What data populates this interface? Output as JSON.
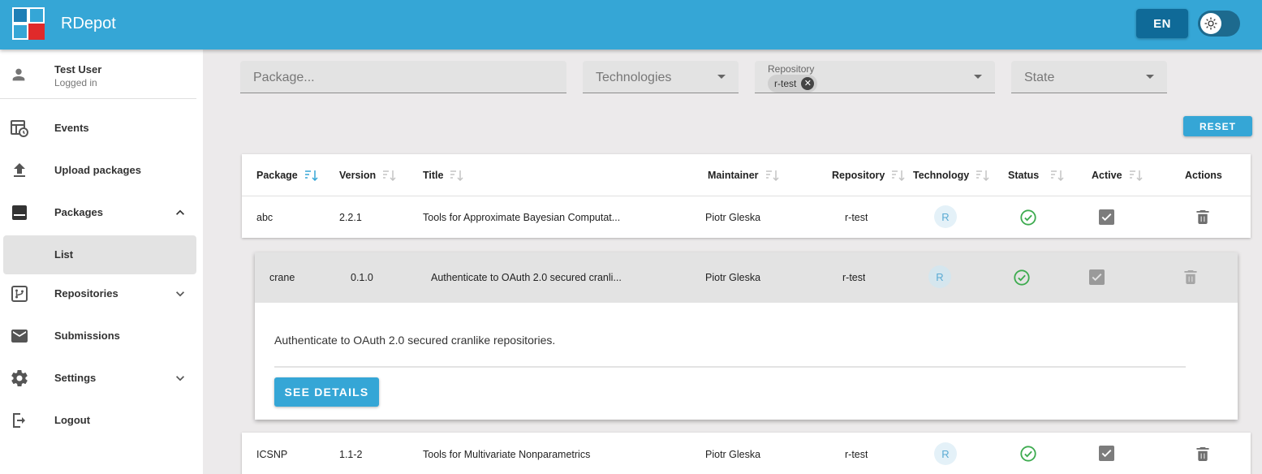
{
  "app": {
    "title": "RDepot",
    "language_label": "EN",
    "theme_toggle_icon": "sun-icon"
  },
  "user": {
    "name": "Test User",
    "status": "Logged in"
  },
  "sidebar": {
    "items": [
      {
        "label": "Events",
        "icon": "events-icon"
      },
      {
        "label": "Upload packages",
        "icon": "upload-icon"
      },
      {
        "label": "Packages",
        "icon": "packages-icon",
        "expanded": true
      },
      {
        "label": "List",
        "selected": true
      },
      {
        "label": "Repositories",
        "icon": "repositories-icon",
        "expanded": false
      },
      {
        "label": "Submissions",
        "icon": "mail-icon"
      },
      {
        "label": "Settings",
        "icon": "gear-icon",
        "expanded": false
      },
      {
        "label": "Logout",
        "icon": "logout-icon"
      }
    ]
  },
  "filters": {
    "package_placeholder": "Package...",
    "technologies_placeholder": "Technologies",
    "repository_label": "Repository",
    "repository_chip": "r-test",
    "state_placeholder": "State",
    "reset_label": "RESET"
  },
  "table": {
    "columns": [
      "Package",
      "Version",
      "Title",
      "Maintainer",
      "Repository",
      "Technology",
      "Status",
      "Active",
      "Actions"
    ],
    "rows": [
      {
        "package": "abc",
        "version": "2.2.1",
        "title": "Tools for Approximate Bayesian Computat...",
        "maintainer": "Piotr Gleska",
        "repository": "r-test",
        "technology": "R",
        "status": "ok",
        "active": true
      },
      {
        "package": "crane",
        "version": "0.1.0",
        "title": "Authenticate to OAuth 2.0 secured cranli...",
        "maintainer": "Piotr Gleska",
        "repository": "r-test",
        "technology": "R",
        "status": "ok",
        "active": true,
        "expanded": true
      },
      {
        "package": "ICSNP",
        "version": "1.1-2",
        "title": "Tools for Multivariate Nonparametrics",
        "maintainer": "Piotr Gleska",
        "repository": "r-test",
        "technology": "R",
        "status": "ok",
        "active": true
      }
    ],
    "expanded": {
      "description": "Authenticate to OAuth 2.0 secured cranlike repositories.",
      "details_label": "SEE DETAILS"
    }
  },
  "colors": {
    "primary": "#35a6d6",
    "dark_primary": "#0f6a98",
    "success": "#3dab4f",
    "logo_red": "#e02a2a"
  }
}
